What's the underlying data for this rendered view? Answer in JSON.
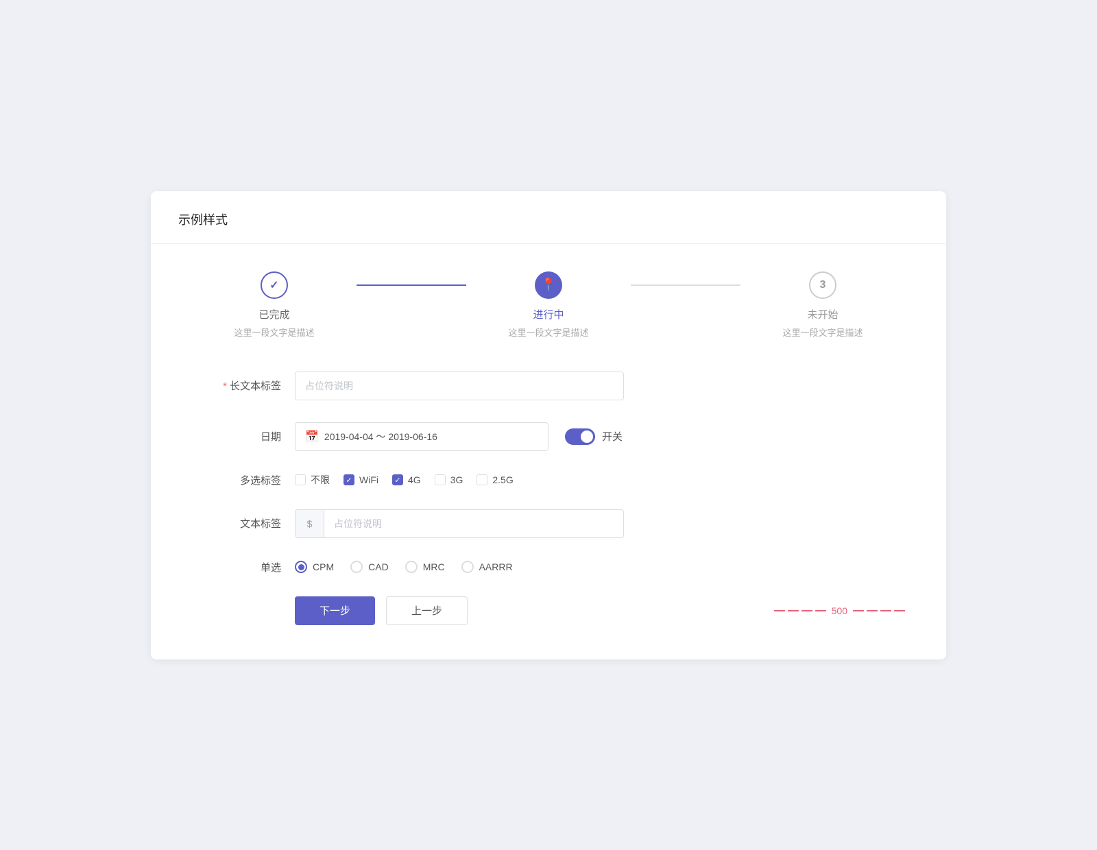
{
  "page": {
    "title": "示例样式"
  },
  "steps": [
    {
      "id": "step1",
      "status": "done",
      "label": "已完成",
      "desc": "这里一段文字是描述",
      "icon": "✓"
    },
    {
      "id": "step2",
      "status": "active",
      "label": "进行中",
      "desc": "这里一段文字是描述",
      "icon": "📍"
    },
    {
      "id": "step3",
      "status": "pending",
      "label": "未开始",
      "desc": "这里一段文字是描述",
      "icon": "3"
    }
  ],
  "form": {
    "long_text_label": "长文本标签",
    "long_text_placeholder": "占位符说明",
    "required_star": "*",
    "date_label": "日期",
    "date_value": "2019-04-04 ～ 2019-06-16",
    "toggle_label": "开关",
    "toggle_on": true,
    "checkbox_label": "多选标签",
    "checkboxes": [
      {
        "id": "unlimited",
        "label": "不限",
        "checked": false
      },
      {
        "id": "wifi",
        "label": "WiFi",
        "checked": true
      },
      {
        "id": "4g",
        "label": "4G",
        "checked": true
      },
      {
        "id": "3g",
        "label": "3G",
        "checked": false
      },
      {
        "id": "2.5g",
        "label": "2.5G",
        "checked": false
      }
    ],
    "text_label": "文本标签",
    "text_prefix": "$",
    "text_placeholder": "占位符说明",
    "radio_label": "单选",
    "radios": [
      {
        "id": "cpm",
        "label": "CPM",
        "selected": true
      },
      {
        "id": "cad",
        "label": "CAD",
        "selected": false
      },
      {
        "id": "mrc",
        "label": "MRC",
        "selected": false
      },
      {
        "id": "aarrr",
        "label": "AARRR",
        "selected": false
      }
    ]
  },
  "buttons": {
    "next": "下一步",
    "prev": "上一步"
  },
  "dashed": {
    "number": "500"
  }
}
